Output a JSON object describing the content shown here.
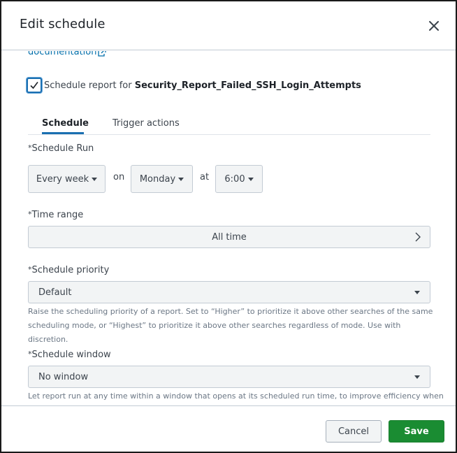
{
  "dialog": {
    "title": "Edit schedule",
    "close_icon": "close-icon"
  },
  "doc_link": {
    "label": "documentation",
    "icon": "external-link-icon"
  },
  "schedule_checkbox": {
    "checked": true,
    "label_prefix": "Schedule report for",
    "report_name": "Security_Report_Failed_SSH_Login_Attempts"
  },
  "tabs": [
    {
      "label": "Schedule",
      "active": true
    },
    {
      "label": "Trigger actions",
      "active": false
    }
  ],
  "required_mark": "*",
  "schedule_run": {
    "label": "Schedule Run",
    "frequency": "Every week",
    "on_text": "on",
    "day": "Monday",
    "at_text": "at",
    "time": "6:00"
  },
  "time_range": {
    "label": "Time range",
    "value": "All time"
  },
  "schedule_priority": {
    "label": "Schedule priority",
    "value": "Default",
    "help": "Raise the scheduling priority of a report. Set to “Higher” to prioritize it above other searches of the same scheduling mode, or “Highest” to prioritize it above other searches regardless of mode. Use with discretion."
  },
  "schedule_window": {
    "label": "Schedule window",
    "value": "No window",
    "help": "Let report run at any time within a window that opens at its scheduled run time, to improve efficiency when"
  },
  "footer": {
    "cancel_label": "Cancel",
    "save_label": "Save"
  },
  "colors": {
    "accent": "#1a6fb1",
    "link": "#006eaa",
    "save": "#1a8c32"
  }
}
